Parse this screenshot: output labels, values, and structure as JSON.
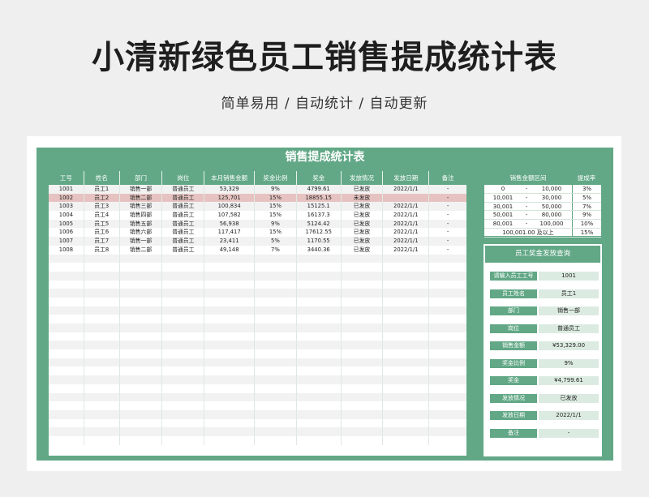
{
  "page": {
    "title": "小清新绿色员工销售提成统计表",
    "subtitle": "简单易用 / 自动统计 / 自动更新"
  },
  "sheet": {
    "banner": "销售提成统计表",
    "columns": [
      "工号",
      "姓名",
      "部门",
      "岗位",
      "本月销售金额",
      "奖金比例",
      "奖金",
      "发放情况",
      "发放日期",
      "备注"
    ],
    "rows": [
      [
        "1001",
        "员工1",
        "销售一部",
        "普通员工",
        "53,329",
        "9%",
        "4799.61",
        "已发放",
        "2022/1/1",
        "-"
      ],
      [
        "1002",
        "员工2",
        "销售二部",
        "普通员工",
        "125,701",
        "15%",
        "18855.15",
        "未发放",
        "",
        "-"
      ],
      [
        "1003",
        "员工3",
        "销售三部",
        "普通员工",
        "100,834",
        "15%",
        "15125.1",
        "已发放",
        "2022/1/1",
        "-"
      ],
      [
        "1004",
        "员工4",
        "销售四部",
        "普通员工",
        "107,582",
        "15%",
        "16137.3",
        "已发放",
        "2022/1/1",
        "-"
      ],
      [
        "1005",
        "员工5",
        "销售五部",
        "普通员工",
        "56,938",
        "9%",
        "5124.42",
        "已发放",
        "2022/1/1",
        "-"
      ],
      [
        "1006",
        "员工6",
        "销售六部",
        "普通员工",
        "117,417",
        "15%",
        "17612.55",
        "已发放",
        "2022/1/1",
        "-"
      ],
      [
        "1007",
        "员工7",
        "销售一部",
        "普通员工",
        "23,411",
        "5%",
        "1170.55",
        "已发放",
        "2022/1/1",
        "-"
      ],
      [
        "1008",
        "员工8",
        "销售二部",
        "普通员工",
        "49,148",
        "7%",
        "3440.36",
        "已发放",
        "2022/1/1",
        "-"
      ]
    ],
    "highlight_row_index": 1,
    "empty_rows": 22
  },
  "tiers": {
    "header_range": "销售金额区间",
    "header_rate": "提成率",
    "rows": [
      {
        "from": "0",
        "dash": "-",
        "to": "10,000",
        "rate": "3%"
      },
      {
        "from": "10,001",
        "dash": "-",
        "to": "30,000",
        "rate": "5%"
      },
      {
        "from": "30,001",
        "dash": "-",
        "to": "50,000",
        "rate": "7%"
      },
      {
        "from": "50,001",
        "dash": "-",
        "to": "80,000",
        "rate": "9%"
      },
      {
        "from": "80,001",
        "dash": "-",
        "to": "100,000",
        "rate": "10%"
      },
      {
        "from": "100,001.00 及以上",
        "dash": "",
        "to": "",
        "rate": "15%"
      }
    ]
  },
  "lookup": {
    "title": "员工奖金发放查询",
    "fields": [
      {
        "label": "请输入员工工号",
        "value": "1001"
      },
      {
        "label": "员工姓名",
        "value": "员工1"
      },
      {
        "label": "部门",
        "value": "销售一部"
      },
      {
        "label": "岗位",
        "value": "普通员工"
      },
      {
        "label": "销售金额",
        "value": "¥53,329.00"
      },
      {
        "label": "奖金比例",
        "value": "9%"
      },
      {
        "label": "奖金",
        "value": "¥4,799.61"
      },
      {
        "label": "发放情况",
        "value": "已发放"
      },
      {
        "label": "发放日期",
        "value": "2022/1/1"
      },
      {
        "label": "备注",
        "value": "-"
      }
    ]
  },
  "colors": {
    "accent": "#62a886",
    "highlight": "#e6c3c0",
    "value_bg": "#dcebe1"
  }
}
